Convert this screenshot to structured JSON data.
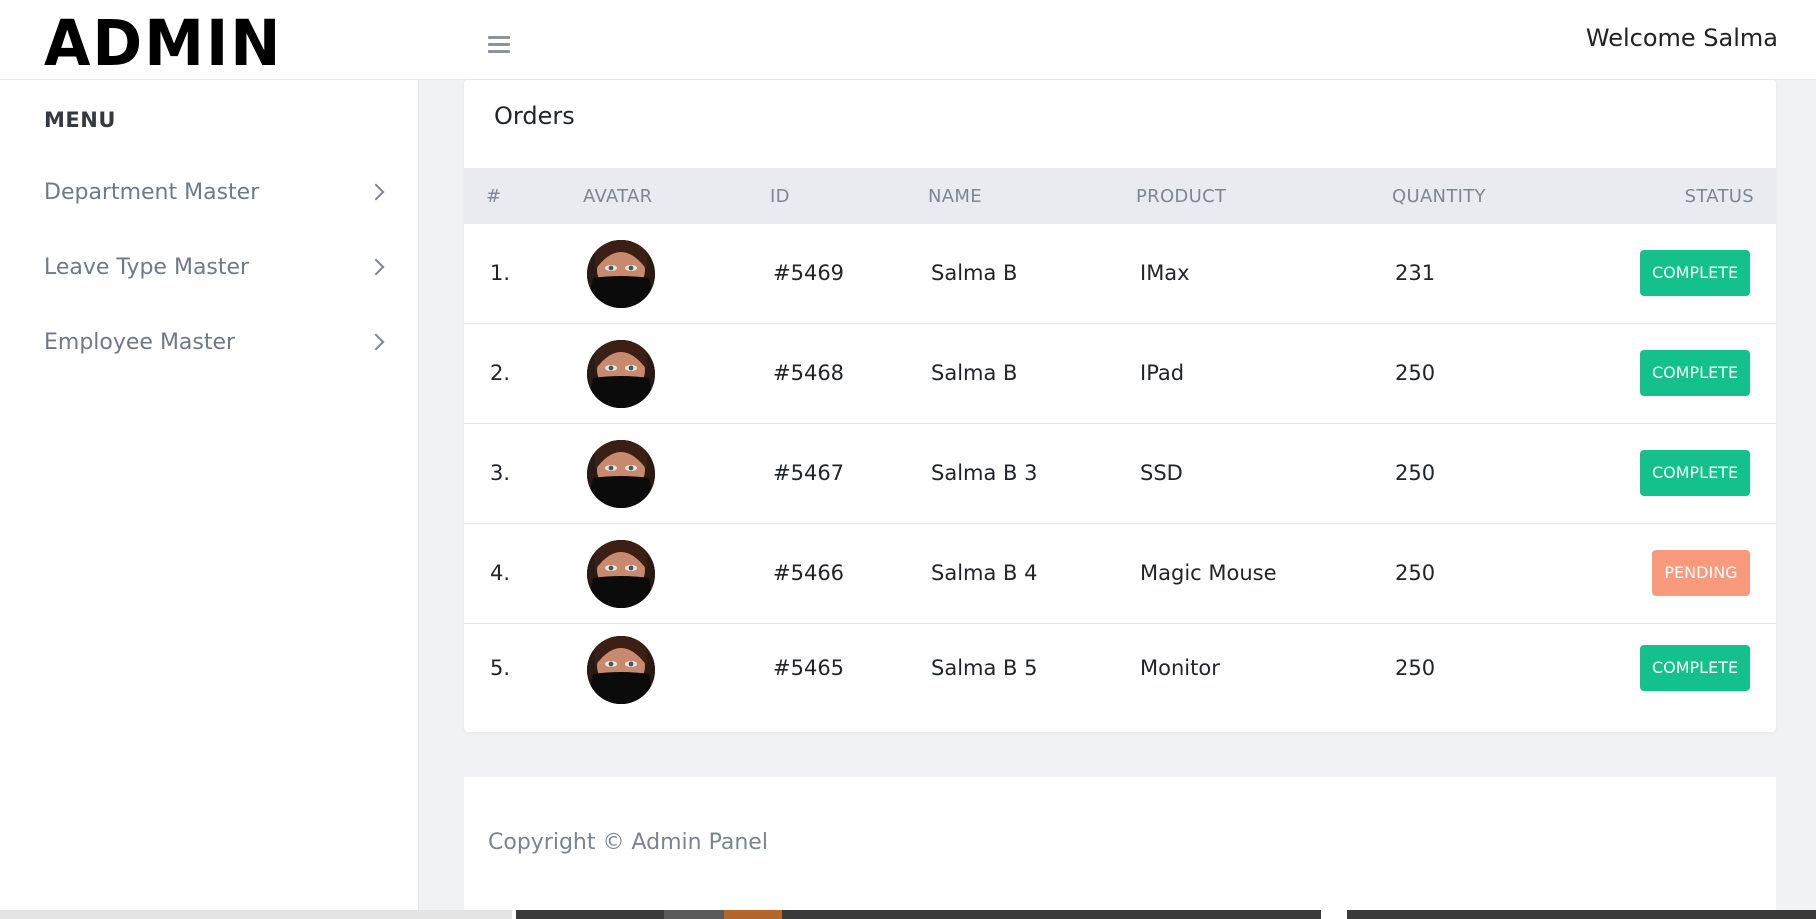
{
  "header": {
    "logo": "ADMIN",
    "welcome": "Welcome Salma"
  },
  "sidebar": {
    "menu_title": "MENU",
    "items": [
      {
        "label": "Department Master"
      },
      {
        "label": "Leave Type Master"
      },
      {
        "label": "Employee Master"
      }
    ]
  },
  "orders": {
    "title": "Orders",
    "columns": [
      "#",
      "AVATAR",
      "ID",
      "NAME",
      "PRODUCT",
      "QUANTITY",
      "STATUS"
    ],
    "rows": [
      {
        "num": "1.",
        "id": "#5469",
        "name": "Salma B",
        "product": "IMax",
        "quantity": "231",
        "status": "COMPLETE"
      },
      {
        "num": "2.",
        "id": "#5468",
        "name": "Salma B",
        "product": "IPad",
        "quantity": "250",
        "status": "COMPLETE"
      },
      {
        "num": "3.",
        "id": "#5467",
        "name": "Salma B 3",
        "product": "SSD",
        "quantity": "250",
        "status": "COMPLETE"
      },
      {
        "num": "4.",
        "id": "#5466",
        "name": "Salma B 4",
        "product": "Magic Mouse",
        "quantity": "250",
        "status": "PENDING"
      },
      {
        "num": "5.",
        "id": "#5465",
        "name": "Salma B 5",
        "product": "Monitor",
        "quantity": "250",
        "status": "COMPLETE"
      }
    ]
  },
  "footer": {
    "copyright": "Copyright © Admin Panel"
  },
  "colors": {
    "complete": "#14c08c",
    "pending": "#fa9a7d",
    "background": "#f1f2f6"
  }
}
